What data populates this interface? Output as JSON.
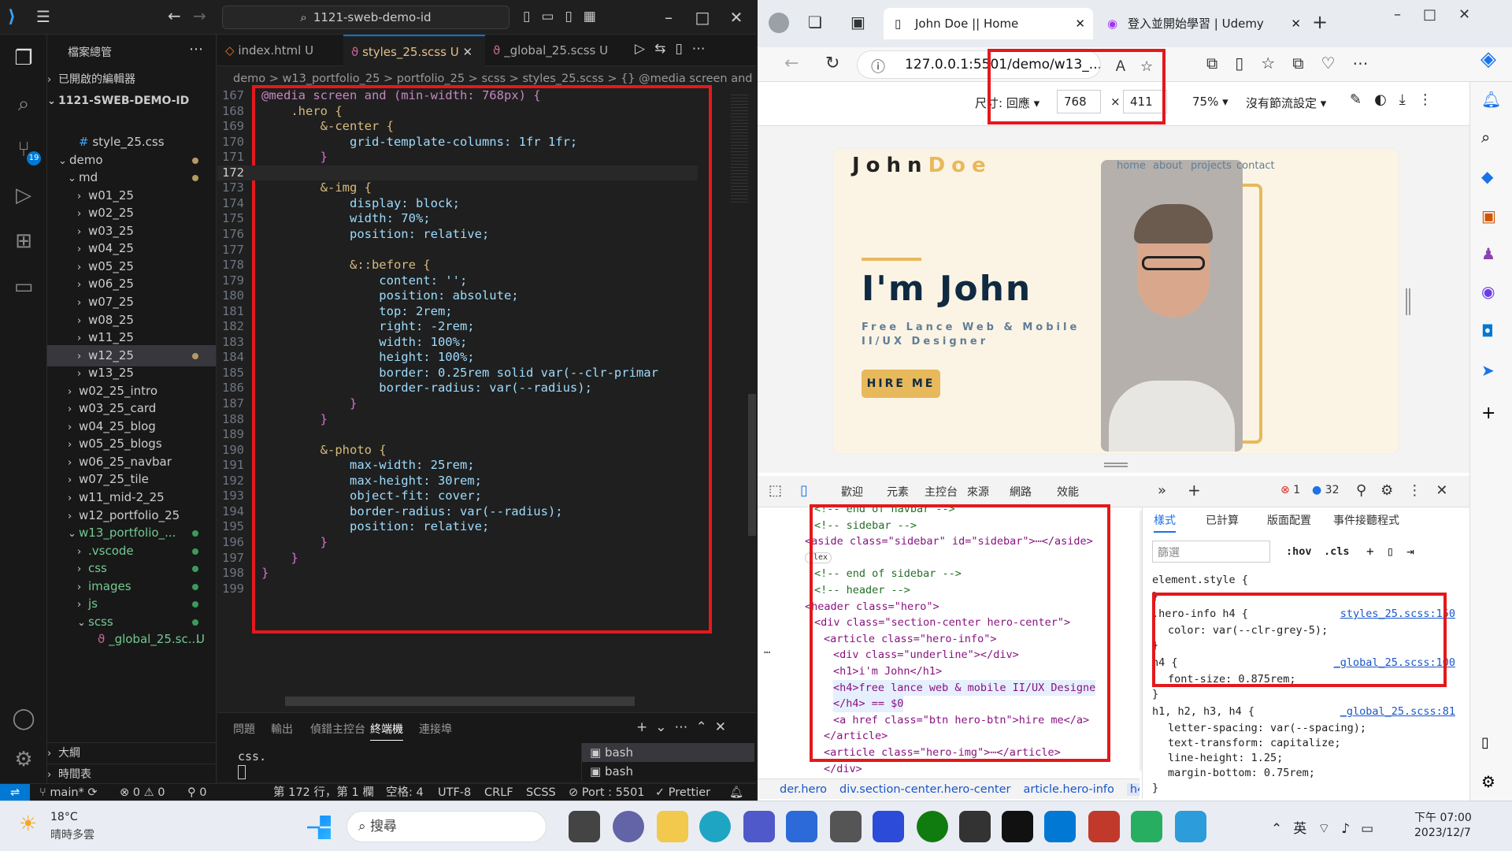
{
  "vscode": {
    "command_center": "1121-sweb-demo-id",
    "sidebar": {
      "title": "檔案總管",
      "open_editors": "已開啟的編輯器",
      "workspace": "1121-SWEB-DEMO-ID",
      "items": [
        {
          "label": "style_25.css",
          "icon": "#"
        },
        {
          "label": "demo"
        },
        {
          "label": "md"
        },
        {
          "label": "w01_25"
        },
        {
          "label": "w02_25"
        },
        {
          "label": "w03_25"
        },
        {
          "label": "w04_25"
        },
        {
          "label": "w05_25"
        },
        {
          "label": "w06_25"
        },
        {
          "label": "w07_25"
        },
        {
          "label": "w08_25"
        },
        {
          "label": "w11_25"
        },
        {
          "label": "w12_25"
        },
        {
          "label": "w13_25"
        },
        {
          "label": "w02_25_intro"
        },
        {
          "label": "w03_25_card"
        },
        {
          "label": "w04_25_blog"
        },
        {
          "label": "w05_25_blogs"
        },
        {
          "label": "w06_25_navbar"
        },
        {
          "label": "w07_25_tile"
        },
        {
          "label": "w11_mid-2_25"
        },
        {
          "label": "w12_portfolio_25"
        },
        {
          "label": "w13_portfolio_..."
        },
        {
          "label": ".vscode"
        },
        {
          "label": "css"
        },
        {
          "label": "images"
        },
        {
          "label": "js"
        },
        {
          "label": "scss"
        },
        {
          "label": "_global_25.sc...",
          "badge": "U"
        }
      ],
      "outline": "大綱",
      "timeline": "時間表"
    },
    "tabs": [
      {
        "label": "index.html",
        "badge": "U"
      },
      {
        "label": "styles_25.scss",
        "badge": "U"
      },
      {
        "label": "_global_25.scss",
        "badge": "U"
      }
    ],
    "breadcrumb": "demo > w13_portfolio_25 > portfolio_25 > scss > styles_25.scss > {} @media screen and",
    "code": [
      {
        "n": "167",
        "t": "@media screen and (min-width: 768px) {"
      },
      {
        "n": "168",
        "t": "    .hero {"
      },
      {
        "n": "169",
        "t": "        &-center {"
      },
      {
        "n": "170",
        "t": "            grid-template-columns: 1fr 1fr;"
      },
      {
        "n": "171",
        "t": "        }"
      },
      {
        "n": "172",
        "t": ""
      },
      {
        "n": "173",
        "t": "        &-img {"
      },
      {
        "n": "174",
        "t": "            display: block;"
      },
      {
        "n": "175",
        "t": "            width: 70%;"
      },
      {
        "n": "176",
        "t": "            position: relative;"
      },
      {
        "n": "177",
        "t": ""
      },
      {
        "n": "178",
        "t": "            &::before {"
      },
      {
        "n": "179",
        "t": "                content: '';"
      },
      {
        "n": "180",
        "t": "                position: absolute;"
      },
      {
        "n": "181",
        "t": "                top: 2rem;"
      },
      {
        "n": "182",
        "t": "                right: -2rem;"
      },
      {
        "n": "183",
        "t": "                width: 100%;"
      },
      {
        "n": "184",
        "t": "                height: 100%;"
      },
      {
        "n": "185",
        "t": "                border: 0.25rem solid var(--clr-primar"
      },
      {
        "n": "186",
        "t": "                border-radius: var(--radius);"
      },
      {
        "n": "187",
        "t": "            }"
      },
      {
        "n": "188",
        "t": "        }"
      },
      {
        "n": "189",
        "t": ""
      },
      {
        "n": "190",
        "t": "        &-photo {"
      },
      {
        "n": "191",
        "t": "            max-width: 25rem;"
      },
      {
        "n": "192",
        "t": "            max-height: 30rem;"
      },
      {
        "n": "193",
        "t": "            object-fit: cover;"
      },
      {
        "n": "194",
        "t": "            border-radius: var(--radius);"
      },
      {
        "n": "195",
        "t": "            position: relative;"
      },
      {
        "n": "196",
        "t": "        }"
      },
      {
        "n": "197",
        "t": "    }"
      },
      {
        "n": "198",
        "t": "}"
      },
      {
        "n": "199",
        "t": ""
      }
    ],
    "panel_tabs": [
      "問題",
      "輸出",
      "偵錯主控台",
      "終端機",
      "連接埠"
    ],
    "terminal_text": "css.",
    "terminals": [
      "bash",
      "bash"
    ],
    "status": {
      "branch": "main*",
      "errors": "0",
      "warnings": "0",
      "ports_fwd": "0",
      "position": "第 172 行，第 1 欄",
      "spaces": "空格: 4",
      "encoding": "UTF-8",
      "eol": "CRLF",
      "lang": "SCSS",
      "port": "Port : 5501",
      "prettier": "Prettier"
    }
  },
  "edge": {
    "tabs": [
      "John Doe || Home",
      "登入並開始學習 | Udemy"
    ],
    "url": "127.0.0.1:5501/demo/w13_...",
    "device_toolbar": {
      "dimensions_label": "尺寸: 回應",
      "width": "768",
      "height": "411",
      "zoom": "75%",
      "throttle": "沒有節流設定"
    },
    "site": {
      "logo_a": "John",
      "logo_b": "Doe",
      "nav": [
        "home",
        "about",
        "projects",
        "contact"
      ],
      "heading": "I'm John",
      "subtitle": "Free Lance Web & Mobile II/UX Designer",
      "button": "HIRE ME"
    },
    "devtools": {
      "tabs": [
        "歡迎",
        "元素",
        "主控台",
        "來源",
        "網路",
        "效能"
      ],
      "errors": "1",
      "messages": "32",
      "dom": [
        "<!-- end of navbar -->",
        "<!-- sidebar -->",
        "<aside class=\"sidebar\" id=\"sidebar\">⋯</aside>",
        "flex",
        "<!-- end of sidebar -->",
        "<!-- header -->",
        "<header class=\"hero\">",
        "<div class=\"section-center hero-center\">",
        "<article class=\"hero-info\">",
        "<div class=\"underline\"></div>",
        "<h1>i'm John</h1>",
        "<h4>free lance web & mobile II/UX Designe",
        "</h4> == $0",
        "<a href class=\"btn hero-btn\">hire me</a>",
        "</article>",
        "<article class=\"hero-img\">⋯</article>",
        "</div>"
      ],
      "breadcrumb": [
        "der.hero",
        "div.section-center.hero-center",
        "article.hero-info",
        "h4"
      ],
      "styles_tabs": [
        "樣式",
        "已計算",
        "版面配置",
        "事件接聽程式"
      ],
      "filter_placeholder": "篩選",
      "hov": ":hov",
      "cls": ".cls",
      "rules": [
        {
          "sel": "element.style {",
          "src": "",
          "props": []
        },
        {
          "sel": ".hero-info h4 {",
          "src": "styles_25.scss:150",
          "props": [
            "color: var(--clr-grey-5);"
          ]
        },
        {
          "sel": "h4 {",
          "src": "_global_25.scss:100",
          "props": [
            "font-size: 0.875rem;"
          ]
        },
        {
          "sel": "h1, h2, h3, h4 {",
          "src": "_global_25.scss:81",
          "props": [
            "letter-spacing: var(--spacing);",
            "text-transform: capitalize;",
            "line-height: 1.25;",
            "margin-bottom: 0.75rem;"
          ]
        }
      ]
    }
  },
  "taskbar": {
    "temp": "18°C",
    "weather": "晴時多雲",
    "search": "搜尋",
    "ime": "英",
    "time": "下午 07:00",
    "date": "2023/12/7"
  }
}
